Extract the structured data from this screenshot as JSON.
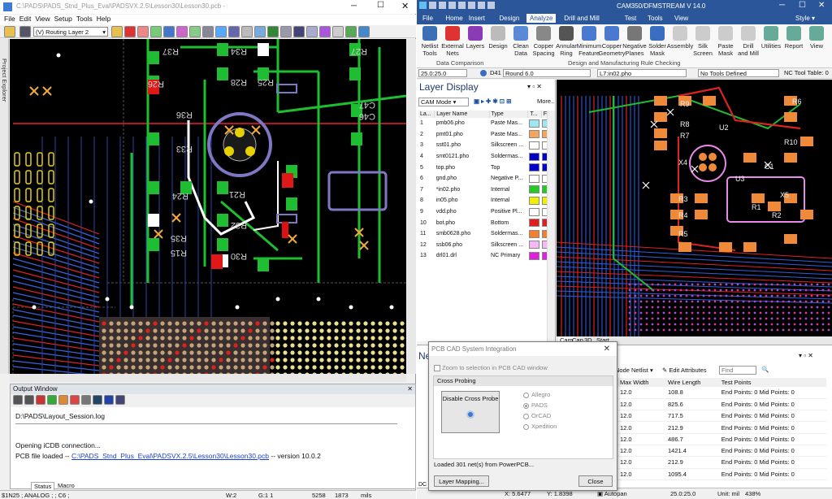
{
  "pads": {
    "title": "C:\\PADS\\PADS_Stnd_Plus_Eval\\PADSVX.2.5\\Lesson30\\Lesson30.pcb - PADS Layout",
    "menu": [
      "File",
      "Edit",
      "View",
      "Setup",
      "Tools",
      "Help"
    ],
    "layer_combo": "(V) Routing Layer 2",
    "project_explorer": "Project Explorer",
    "silk": [
      "R37",
      "R34",
      "R27",
      "R28",
      "R26",
      "R25",
      "C47",
      "C46",
      "R36",
      "R33",
      "R21",
      "R24",
      "R35",
      "R15",
      "R32",
      "R30"
    ],
    "output_title": "Output Window",
    "log_path": "D:\\PADS\\Layout_Session.log",
    "line1": "Opening iCDB connection...",
    "line2_prefix": "PCB file loaded -- ",
    "line2_link": "C:\\PADS_Stnd_Plus_Eval\\PADSVX.2.5\\Lesson30\\Lesson30.pcb",
    "line2_suffix": " -- version 10.0.2",
    "tabs": [
      "Status",
      "Macro"
    ],
    "status": {
      "left": "$1N25 ; ANALOG ; ; C6 ;",
      "w": "W:2",
      "g": "G:1 1",
      "x": "5258",
      "y": "1873",
      "units": "mils"
    }
  },
  "cam": {
    "title": "CAM350/DFMSTREAM V 14.0",
    "tabs": [
      "File",
      "Home",
      "Insert",
      "Design",
      "Analyze",
      "Drill and Mill",
      "Test",
      "Tools",
      "View"
    ],
    "active_tab": "Analyze",
    "style": "Style",
    "ribbon": [
      {
        "l1": "Netlist",
        "l2": "Tools",
        "c": "#3b6fb6"
      },
      {
        "l1": "External",
        "l2": "Nets",
        "c": "#d33"
      },
      {
        "l1": "Layers",
        "l2": "",
        "c": "#8a3bb6"
      },
      {
        "l1": "Design",
        "l2": "",
        "c": "#bbb"
      },
      {
        "l1": "Clean",
        "l2": "Data",
        "c": "#5a8ad6"
      },
      {
        "l1": "Copper",
        "l2": "Spacing",
        "c": "#888"
      },
      {
        "l1": "Annular",
        "l2": "Ring",
        "c": "#555"
      },
      {
        "l1": "Minimum",
        "l2": "Feature",
        "c": "#4a7ad0"
      },
      {
        "l1": "Copper",
        "l2": "Geometry",
        "c": "#4a7ad0"
      },
      {
        "l1": "Negative",
        "l2": "Planes",
        "c": "#777"
      },
      {
        "l1": "Solder",
        "l2": "Mask",
        "c": "#3a6ec0"
      },
      {
        "l1": "Assembly",
        "l2": "",
        "c": "#ccc"
      },
      {
        "l1": "Silk",
        "l2": "Screen",
        "c": "#ccc"
      },
      {
        "l1": "Paste",
        "l2": "Mask",
        "c": "#ccc"
      },
      {
        "l1": "Drill",
        "l2": "and Mill",
        "c": "#ccc"
      },
      {
        "l1": "Utilities",
        "l2": "",
        "c": "#6a9"
      },
      {
        "l1": "Report",
        "l2": "",
        "c": "#6a9"
      },
      {
        "l1": "View",
        "l2": "",
        "c": "#6a9"
      }
    ],
    "group1": "Data Comparison",
    "group2": "Design and Manufacturing Rule Checking",
    "tb2": {
      "zoom": "25.0:25.0",
      "dcode": "D41",
      "aperture": "Round 6.0",
      "layer": "L7:in02.pho",
      "tools": "No Tools Defined",
      "nc": "NC Tool Table: 0"
    },
    "layer_display": "Layer Display",
    "cam_mode": "CAM Mode",
    "more": "More..",
    "layer_headers": [
      "La...",
      "Layer Name",
      "Type",
      "T...",
      "F..."
    ],
    "layers": [
      {
        "n": "1",
        "name": "pmb06.pho",
        "type": "Paste Mas...",
        "c1": "#9ee7f0",
        "c2": "#9ee7f0"
      },
      {
        "n": "2",
        "name": "pmt01.pho",
        "type": "Paste Mas...",
        "c1": "#f4a55a",
        "c2": "#f4a55a"
      },
      {
        "n": "3",
        "name": "sst01.pho",
        "type": "Silkscreen ...",
        "c1": "#ffffff",
        "c2": "#ffffff"
      },
      {
        "n": "4",
        "name": "smt0121.pho",
        "type": "Soldermas...",
        "c1": "#0000c8",
        "c2": "#0000c8"
      },
      {
        "n": "5",
        "name": "top.pho",
        "type": "Top",
        "c1": "#0000c8",
        "c2": "#0000c8"
      },
      {
        "n": "6",
        "name": "gnd.pho",
        "type": "Negative P...",
        "c1": "#ffffff",
        "c2": "#ffffff"
      },
      {
        "n": "7",
        "name": "*in02.pho",
        "type": "Internal",
        "c1": "#22cc22",
        "c2": "#22cc22"
      },
      {
        "n": "8",
        "name": "in05.pho",
        "type": "Internal",
        "c1": "#f0f000",
        "c2": "#f0f000"
      },
      {
        "n": "9",
        "name": "vdd.pho",
        "type": "Positive Pl...",
        "c1": "#ffffff",
        "c2": "#ffffff"
      },
      {
        "n": "10",
        "name": "bot.pho",
        "type": "Bottom",
        "c1": "#e02020",
        "c2": "#e02020"
      },
      {
        "n": "11",
        "name": "smb0628.pho",
        "type": "Soldermas...",
        "c1": "#f08030",
        "c2": "#f08030"
      },
      {
        "n": "12",
        "name": "ssb06.pho",
        "type": "Silkscreen ...",
        "c1": "#f8b8f8",
        "c2": "#f8b8f8"
      },
      {
        "n": "13",
        "name": "drl01.drl",
        "type": "NC Primary",
        "c1": "#e020e0",
        "c2": "#e020e0"
      }
    ],
    "silk": [
      "R9",
      "R8",
      "R7",
      "U2",
      "X4",
      "C1",
      "R3",
      "R4",
      "R5",
      "R1",
      "R2",
      "X5",
      "R6",
      "R10",
      "U3"
    ],
    "canvas_tabs": [
      "Cam",
      "Cap",
      "3D",
      "Start"
    ],
    "netlist": {
      "title": "Ne",
      "node_netlist": "Node Netlist",
      "edit_attrs": "Edit Attributes",
      "find": "Find",
      "headers": [
        "Max Width",
        "Wire Length",
        "Test Points"
      ],
      "rows": [
        [
          "12.0",
          "108.8",
          "End Points: 0 Mid Points: 0"
        ],
        [
          "12.0",
          "825.6",
          "End Points: 0 Mid Points: 0"
        ],
        [
          "12.0",
          "717.5",
          "End Points: 0 Mid Points: 0"
        ],
        [
          "12.0",
          "212.9",
          "End Points: 0 Mid Points: 0"
        ],
        [
          "12.0",
          "486.7",
          "End Points: 0 Mid Points: 0"
        ],
        [
          "12.0",
          "1421.4",
          "End Points: 0 Mid Points: 0"
        ],
        [
          "12.0",
          "212.9",
          "End Points: 0 Mid Points: 0"
        ],
        [
          "12.0",
          "1095.4",
          "End Points: 0 Mid Points: 0"
        ]
      ]
    },
    "status": {
      "x": "X: 5.6477",
      "y": "Y: 1.8398",
      "autopan": "Autopan",
      "zoom": "25.0:25.0",
      "unit": "Unit: mil",
      "pct": "438%",
      "bottom_left": "DC"
    }
  },
  "dialog": {
    "title": "PCB CAD System Integration",
    "zoom_check": "Zoom to selection in PCB CAD window",
    "group": "Cross Probing",
    "button": "Disable Cross Probe",
    "radios": [
      "Allegro",
      "PADS",
      "OrCAD",
      "Xpedition"
    ],
    "selected": "PADS",
    "loaded": "Loaded 301 net(s) from PowerPCB...",
    "mapping": "Layer Mapping...",
    "close": "Close"
  }
}
